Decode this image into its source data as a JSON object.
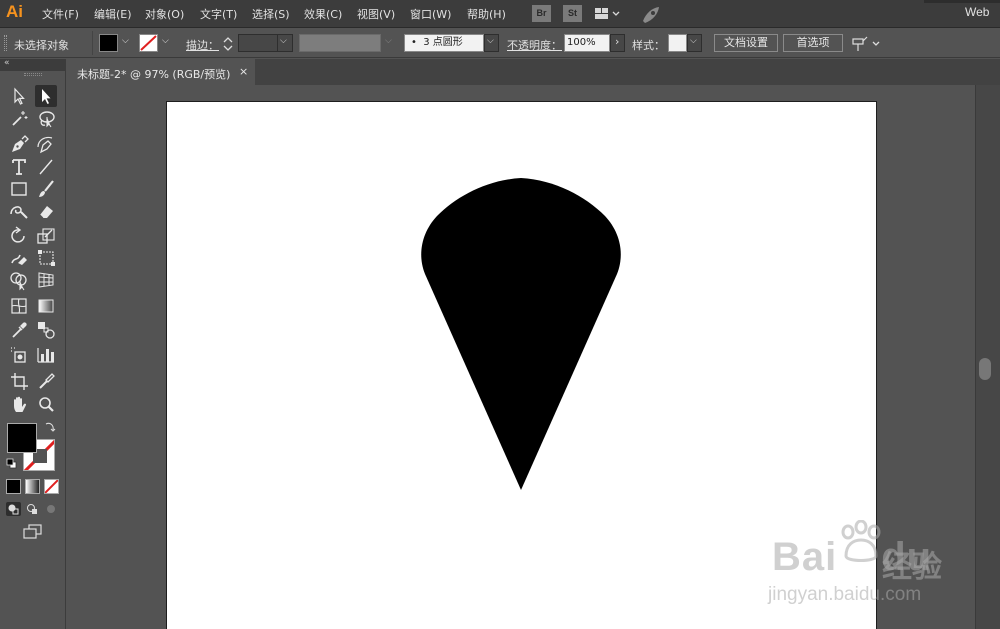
{
  "app": {
    "logo": "Ai",
    "workspace_label": "Web"
  },
  "menu": [
    "文件(F)",
    "编辑(E)",
    "对象(O)",
    "文字(T)",
    "选择(S)",
    "效果(C)",
    "视图(V)",
    "窗口(W)",
    "帮助(H)"
  ],
  "menubar_buttons": {
    "bridge": "Br",
    "stock": "St"
  },
  "control": {
    "selection_status": "未选择对象",
    "stroke_label": "描边：",
    "brush": "3 点圆形",
    "opacity_label": "不透明度：",
    "opacity_value": "100%",
    "style_label": "样式：",
    "doc_setup": "文档设置",
    "prefs": "首选项"
  },
  "document": {
    "tab_title": "未标题-2* @ 97% (RGB/预览)",
    "close_glyph": "×",
    "fill_color": "#000000"
  },
  "colors": {
    "fill": "#000000",
    "stroke": "none",
    "chrome": "#535353",
    "accent": "#f7931e"
  },
  "watermark": {
    "brand": "Bai",
    "brand_tail": "du",
    "brand_cn": "经验",
    "url": "jingyan.baidu.com"
  },
  "tools": [
    "selection-tool",
    "direct-selection-tool",
    "magic-wand-tool",
    "lasso-tool",
    "pen-tool",
    "curvature-tool",
    "type-tool",
    "line-tool",
    "rectangle-tool",
    "paintbrush-tool",
    "shaper-tool",
    "eraser-tool",
    "rotate-tool",
    "scale-tool",
    "warp-tool",
    "free-transform-tool",
    "shape-builder-tool",
    "perspective-grid-tool",
    "mesh-tool",
    "gradient-tool",
    "eyedropper-tool",
    "blend-tool",
    "symbol-sprayer-tool",
    "column-graph-tool",
    "artboard-tool",
    "slice-tool",
    "hand-tool",
    "zoom-tool"
  ]
}
